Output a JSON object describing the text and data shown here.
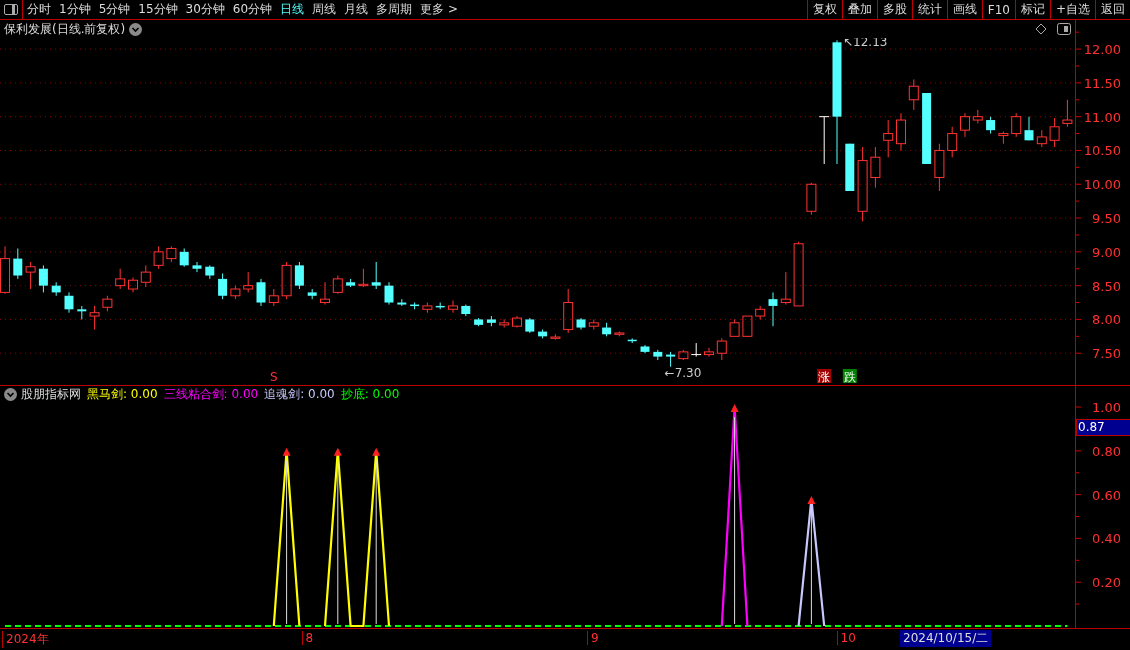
{
  "toolbar": {
    "periods": [
      {
        "label": "分时",
        "selected": false
      },
      {
        "label": "1分钟",
        "selected": false
      },
      {
        "label": "5分钟",
        "selected": false
      },
      {
        "label": "15分钟",
        "selected": false
      },
      {
        "label": "30分钟",
        "selected": false
      },
      {
        "label": "60分钟",
        "selected": false
      },
      {
        "label": "日线",
        "selected": true
      },
      {
        "label": "周线",
        "selected": false
      },
      {
        "label": "月线",
        "selected": false
      },
      {
        "label": "多周期",
        "selected": false
      },
      {
        "label": "更多 >",
        "selected": false
      }
    ],
    "buttons": [
      "复权",
      "叠加",
      "多股",
      "统计",
      "画线",
      "F10",
      "标记",
      "+自选",
      "返回"
    ]
  },
  "price_panel": {
    "title": "保利发展(日线.前复权)",
    "chart_data": {
      "type": "candlestick",
      "grid": true,
      "ylim": [
        7.03,
        12.43
      ],
      "yticks": [
        {
          "value": 7.5,
          "label": "7.50"
        },
        {
          "value": 8.0,
          "label": "8.00"
        },
        {
          "value": 8.5,
          "label": "8.50"
        },
        {
          "value": 9.0,
          "label": "9.00"
        },
        {
          "value": 9.5,
          "label": "9.50"
        },
        {
          "value": 10.0,
          "label": "10.00"
        },
        {
          "value": 10.5,
          "label": "10.50"
        },
        {
          "value": 11.0,
          "label": "11.00"
        },
        {
          "value": 11.5,
          "label": "11.50"
        },
        {
          "value": 12.0,
          "label": "12.00"
        }
      ],
      "ohlc": [
        [
          8.4,
          9.08,
          8.38,
          8.9
        ],
        [
          8.9,
          9.05,
          8.6,
          8.65
        ],
        [
          8.7,
          8.85,
          8.45,
          8.78
        ],
        [
          8.75,
          8.8,
          8.4,
          8.5
        ],
        [
          8.5,
          8.55,
          8.35,
          8.4
        ],
        [
          8.35,
          8.4,
          8.1,
          8.15
        ],
        [
          8.15,
          8.2,
          8.0,
          8.12
        ],
        [
          8.05,
          8.2,
          7.85,
          8.1
        ],
        [
          8.18,
          8.35,
          8.12,
          8.3
        ],
        [
          8.5,
          8.75,
          8.45,
          8.6
        ],
        [
          8.45,
          8.62,
          8.4,
          8.58
        ],
        [
          8.55,
          8.8,
          8.48,
          8.7
        ],
        [
          8.8,
          9.08,
          8.75,
          9.0
        ],
        [
          8.9,
          9.08,
          8.85,
          9.05
        ],
        [
          9.0,
          9.05,
          8.78,
          8.8
        ],
        [
          8.8,
          8.85,
          8.7,
          8.75
        ],
        [
          8.78,
          8.8,
          8.6,
          8.65
        ],
        [
          8.6,
          8.68,
          8.3,
          8.35
        ],
        [
          8.35,
          8.5,
          8.3,
          8.45
        ],
        [
          8.45,
          8.7,
          8.4,
          8.5
        ],
        [
          8.55,
          8.6,
          8.2,
          8.25
        ],
        [
          8.25,
          8.45,
          8.2,
          8.35
        ],
        [
          8.35,
          8.85,
          8.3,
          8.8
        ],
        [
          8.8,
          8.85,
          8.45,
          8.5
        ],
        [
          8.4,
          8.45,
          8.3,
          8.35
        ],
        [
          8.25,
          8.55,
          8.22,
          8.3
        ],
        [
          8.4,
          8.65,
          8.38,
          8.6
        ],
        [
          8.55,
          8.6,
          8.48,
          8.5
        ],
        [
          8.5,
          8.75,
          8.48,
          8.52
        ],
        [
          8.55,
          8.85,
          8.45,
          8.5
        ],
        [
          8.5,
          8.55,
          8.22,
          8.25
        ],
        [
          8.25,
          8.3,
          8.2,
          8.22
        ],
        [
          8.22,
          8.25,
          8.15,
          8.2
        ],
        [
          8.15,
          8.25,
          8.1,
          8.2
        ],
        [
          8.2,
          8.25,
          8.15,
          8.18
        ],
        [
          8.15,
          8.28,
          8.1,
          8.2
        ],
        [
          8.2,
          8.22,
          8.05,
          8.08
        ],
        [
          8.0,
          8.02,
          7.9,
          7.92
        ],
        [
          8.0,
          8.05,
          7.9,
          7.95
        ],
        [
          7.92,
          8.0,
          7.88,
          7.95
        ],
        [
          7.9,
          8.05,
          7.88,
          8.02
        ],
        [
          8.0,
          8.02,
          7.8,
          7.82
        ],
        [
          7.82,
          7.85,
          7.72,
          7.75
        ],
        [
          7.72,
          7.78,
          7.7,
          7.74
        ],
        [
          7.85,
          8.45,
          7.8,
          8.25
        ],
        [
          8.0,
          8.02,
          7.85,
          7.88
        ],
        [
          7.9,
          8.0,
          7.85,
          7.95
        ],
        [
          7.88,
          7.95,
          7.75,
          7.78
        ],
        [
          7.78,
          7.82,
          7.75,
          7.8
        ],
        [
          7.7,
          7.72,
          7.65,
          7.68
        ],
        [
          7.6,
          7.62,
          7.5,
          7.52
        ],
        [
          7.52,
          7.55,
          7.4,
          7.45
        ],
        [
          7.48,
          7.52,
          7.3,
          7.45
        ],
        [
          7.42,
          7.55,
          7.4,
          7.52
        ],
        [
          7.48,
          7.65,
          7.45,
          7.48
        ],
        [
          7.48,
          7.58,
          7.45,
          7.52
        ],
        [
          7.5,
          7.72,
          7.4,
          7.68
        ],
        [
          7.75,
          8.0,
          7.75,
          7.95
        ],
        [
          7.75,
          8.05,
          7.74,
          8.05
        ],
        [
          8.05,
          8.2,
          8.0,
          8.15
        ],
        [
          8.3,
          8.4,
          7.9,
          8.2
        ],
        [
          8.25,
          8.7,
          8.22,
          8.3
        ],
        [
          8.2,
          9.15,
          8.2,
          9.12
        ],
        [
          9.6,
          10.02,
          9.55,
          10.0
        ],
        [
          11.0,
          11.0,
          10.3,
          11.0
        ],
        [
          12.1,
          12.13,
          10.3,
          11.0
        ],
        [
          10.6,
          10.6,
          9.9,
          9.9
        ],
        [
          9.6,
          10.55,
          9.45,
          10.35
        ],
        [
          10.1,
          10.55,
          9.95,
          10.4
        ],
        [
          10.65,
          10.95,
          10.4,
          10.75
        ],
        [
          10.6,
          11.05,
          10.5,
          10.95
        ],
        [
          11.25,
          11.55,
          11.1,
          11.45
        ],
        [
          11.35,
          11.35,
          10.3,
          10.3
        ],
        [
          10.1,
          10.6,
          9.9,
          10.5
        ],
        [
          10.5,
          10.85,
          10.4,
          10.75
        ],
        [
          10.8,
          11.05,
          10.7,
          11.0
        ],
        [
          10.95,
          11.1,
          10.9,
          11.0
        ],
        [
          10.95,
          11.0,
          10.75,
          10.8
        ],
        [
          10.72,
          10.78,
          10.6,
          10.75
        ],
        [
          10.75,
          11.05,
          10.7,
          11.0
        ],
        [
          10.8,
          11.0,
          10.65,
          10.65
        ],
        [
          10.6,
          10.8,
          10.55,
          10.7
        ],
        [
          10.65,
          10.98,
          10.55,
          10.85
        ],
        [
          10.9,
          11.25,
          10.85,
          10.95
        ]
      ],
      "annotations": [
        "↖12.13",
        "←7.30"
      ]
    },
    "signals": [
      {
        "kind": "sell",
        "text": "S"
      },
      {
        "kind": "rise",
        "text": "涨"
      },
      {
        "kind": "fall",
        "text": "跌"
      }
    ]
  },
  "indicator_panel": {
    "name": "股朋指标网",
    "legend_values": [
      ": 0.00",
      ": 0.00",
      ": 0.00",
      ": 0.00"
    ],
    "current_value": "0.87",
    "chart_data": {
      "type": "line",
      "ylim": [
        -0.0137,
        1.096
      ],
      "yticks": [
        {
          "value": 0.2,
          "label": "0.20"
        },
        {
          "value": 0.4,
          "label": "0.40"
        },
        {
          "value": 0.6,
          "label": "0.60"
        },
        {
          "value": 0.8,
          "label": "0.80"
        },
        {
          "value": 1.0,
          "label": "1.00"
        }
      ],
      "series": [
        {
          "name": "黑马剑",
          "color": "#ffff00",
          "values": [
            null,
            null,
            null,
            null,
            null,
            null,
            null,
            null,
            null,
            null,
            null,
            null,
            null,
            null,
            null,
            null,
            null,
            null,
            null,
            null,
            null,
            0,
            0.8,
            0,
            null,
            0,
            0.8,
            0,
            0,
            0.8,
            0,
            null,
            null,
            null,
            null,
            null,
            null,
            null,
            null,
            null,
            null,
            null,
            null,
            null,
            null,
            null,
            null,
            null,
            null,
            null,
            null,
            null,
            null,
            null,
            null,
            null,
            null,
            null,
            null,
            null,
            null,
            null,
            null,
            null,
            null,
            null,
            null,
            null,
            null,
            null,
            null,
            null,
            null,
            null,
            null,
            null,
            null,
            null,
            null,
            null,
            null,
            null,
            null,
            null
          ]
        },
        {
          "name": "三线粘合剑",
          "color": "#ff00ff",
          "values": [
            null,
            null,
            null,
            null,
            null,
            null,
            null,
            null,
            null,
            null,
            null,
            null,
            null,
            null,
            null,
            null,
            null,
            null,
            null,
            null,
            null,
            null,
            null,
            null,
            null,
            null,
            null,
            null,
            null,
            null,
            null,
            null,
            null,
            null,
            null,
            null,
            null,
            null,
            null,
            null,
            null,
            null,
            null,
            null,
            null,
            null,
            null,
            null,
            null,
            null,
            null,
            null,
            null,
            null,
            null,
            null,
            0,
            1.0,
            0,
            null,
            null,
            null,
            null,
            null,
            null,
            null,
            null,
            null,
            null,
            null,
            null,
            null,
            null,
            null,
            null,
            null,
            null,
            null,
            null,
            null,
            null,
            null,
            null,
            null
          ]
        },
        {
          "name": "追魂剑",
          "color": "#c8c8ff",
          "values": [
            null,
            null,
            null,
            null,
            null,
            null,
            null,
            null,
            null,
            null,
            null,
            null,
            null,
            null,
            null,
            null,
            null,
            null,
            null,
            null,
            null,
            null,
            null,
            null,
            null,
            null,
            null,
            null,
            null,
            null,
            null,
            null,
            null,
            null,
            null,
            null,
            null,
            null,
            null,
            null,
            null,
            null,
            null,
            null,
            null,
            null,
            null,
            null,
            null,
            null,
            null,
            null,
            null,
            null,
            null,
            null,
            null,
            null,
            null,
            null,
            null,
            null,
            0,
            0.58,
            0,
            null,
            null,
            null,
            null,
            null,
            null,
            null,
            null,
            null,
            null,
            null,
            null,
            null,
            null,
            null,
            null,
            null,
            null,
            null
          ]
        },
        {
          "name": "抄底",
          "color": "#00ff00",
          "line_style": "dashed",
          "values": [
            0,
            0,
            0,
            0,
            0,
            0,
            0,
            0,
            0,
            0,
            0,
            0,
            0,
            0,
            0,
            0,
            0,
            0,
            0,
            0,
            0,
            0,
            0,
            0,
            0,
            0,
            0,
            0,
            0,
            0,
            0,
            0,
            0,
            0,
            0,
            0,
            0,
            0,
            0,
            0,
            0,
            0,
            0,
            0,
            0,
            0,
            0,
            0,
            0,
            0,
            0,
            0,
            0,
            0,
            0,
            0,
            0,
            0,
            0,
            0,
            0,
            0,
            0,
            0,
            0,
            0,
            0,
            0,
            0,
            0,
            0,
            0,
            0,
            0,
            0,
            0,
            0,
            0,
            0,
            0,
            0,
            0,
            0,
            0
          ]
        }
      ]
    }
  },
  "time_axis": {
    "labels": [
      "2024年",
      "8",
      "9",
      "10"
    ],
    "cursor_date": "2024/10/15/二"
  }
}
